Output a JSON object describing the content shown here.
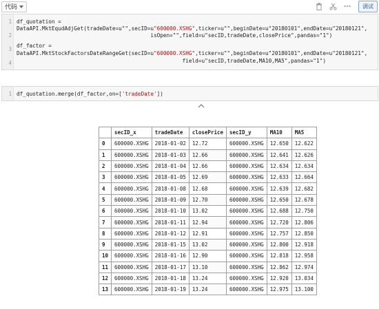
{
  "toolbar": {
    "cell_type": "代码",
    "run_label": "调试",
    "icons": [
      "trash-icon",
      "scissors-icon",
      "more-icon"
    ]
  },
  "cell1": {
    "line_numbers": [
      "1",
      "2",
      "3",
      "4"
    ],
    "lines": [
      {
        "pre": "df_quotation =",
        "str": ""
      },
      {
        "pre": "DataAPI.MktEqudAdjGet(tradeDate=u\"\",secID=u",
        "str": "\"600000.XSHG\"",
        "post": ",ticker=u\"\",beginDate=u\"20180101\",endDate=u\"20180121\","
      },
      {
        "pre": "                                          isOpen=\"\",field=u\"secID,tradeDate,closePrice\",pandas=\"1\")",
        "str": ""
      },
      {
        "pre": "df_factor =",
        "str": ""
      },
      {
        "pre": "DataAPI.MktStockFactorsDateRangeGet(secID=u",
        "str": "\"600000.XSHG\"",
        "post": ",ticker=u\"\",beginDate=u\"20180101\",endDate=u\"20180121\","
      },
      {
        "pre": "                                                    field=u\"secID,tradeDate,MA10,MA5\",pandas=\"1\")",
        "str": ""
      }
    ]
  },
  "cell2": {
    "line_numbers": [
      "1"
    ],
    "code_pre": "df_quotation.merge(df_factor,on=[",
    "code_str": "'tradeDate'",
    "code_post": "])"
  },
  "table": {
    "columns": [
      "",
      "secID_x",
      "tradeDate",
      "closePrice",
      "secID_y",
      "MA10",
      "MA5"
    ],
    "rows": [
      [
        "0",
        "600000.XSHG",
        "2018-01-02",
        "12.72",
        "600000.XSHG",
        "12.650",
        "12.622"
      ],
      [
        "1",
        "600000.XSHG",
        "2018-01-03",
        "12.66",
        "600000.XSHG",
        "12.641",
        "12.626"
      ],
      [
        "2",
        "600000.XSHG",
        "2018-01-04",
        "12.66",
        "600000.XSHG",
        "12.634",
        "12.634"
      ],
      [
        "3",
        "600000.XSHG",
        "2018-01-05",
        "12.69",
        "600000.XSHG",
        "12.633",
        "12.664"
      ],
      [
        "4",
        "600000.XSHG",
        "2018-01-08",
        "12.68",
        "600000.XSHG",
        "12.639",
        "12.682"
      ],
      [
        "5",
        "600000.XSHG",
        "2018-01-09",
        "12.70",
        "600000.XSHG",
        "12.650",
        "12.678"
      ],
      [
        "6",
        "600000.XSHG",
        "2018-01-10",
        "13.02",
        "600000.XSHG",
        "12.688",
        "12.750"
      ],
      [
        "7",
        "600000.XSHG",
        "2018-01-11",
        "12.94",
        "600000.XSHG",
        "12.720",
        "12.806"
      ],
      [
        "8",
        "600000.XSHG",
        "2018-01-12",
        "12.91",
        "600000.XSHG",
        "12.757",
        "12.850"
      ],
      [
        "9",
        "600000.XSHG",
        "2018-01-15",
        "13.02",
        "600000.XSHG",
        "12.800",
        "12.918"
      ],
      [
        "10",
        "600000.XSHG",
        "2018-01-16",
        "12.90",
        "600000.XSHG",
        "12.818",
        "12.958"
      ],
      [
        "11",
        "600000.XSHG",
        "2018-01-17",
        "13.10",
        "600000.XSHG",
        "12.862",
        "12.974"
      ],
      [
        "12",
        "600000.XSHG",
        "2018-01-18",
        "13.24",
        "600000.XSHG",
        "12.920",
        "13.034"
      ],
      [
        "13",
        "600000.XSHG",
        "2018-01-19",
        "13.24",
        "600000.XSHG",
        "12.975",
        "13.100"
      ]
    ]
  }
}
